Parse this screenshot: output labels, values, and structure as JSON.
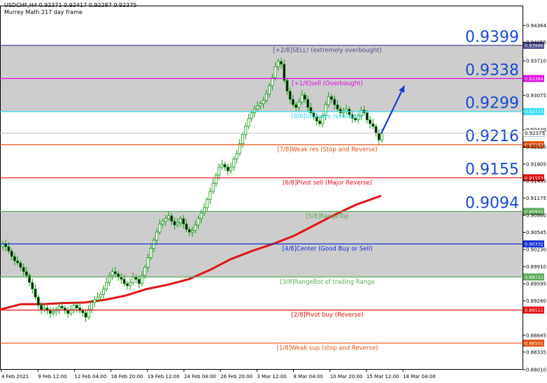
{
  "header": {
    "line1": "USDCHF,H4  0.92371 0.92417 0.92287 0.92375",
    "line2": "Murrey Math 217 day frame"
  },
  "chart_data": {
    "type": "candlestick",
    "symbol": "USDCHF",
    "timeframe": "H4",
    "ohlc": {
      "open": 0.92371,
      "high": 0.92417,
      "low": 0.92287,
      "close": 0.92375
    },
    "current_price_tag": "0.92375",
    "y_range": [
      0.8801,
      0.9473
    ],
    "y_ticks": [
      {
        "v": 0.94364,
        "label": "0.94364"
      },
      {
        "v": 0.94055,
        "label": "0.94055"
      },
      {
        "v": 0.9371,
        "label": "0.93710"
      },
      {
        "v": 0.93075,
        "label": "0.93075"
      },
      {
        "v": 0.9244,
        "label": "0.92440"
      },
      {
        "v": 0.92125,
        "label": "0.92125"
      },
      {
        "v": 0.91805,
        "label": "0.91805"
      },
      {
        "v": 0.91495,
        "label": "0.91495"
      },
      {
        "v": 0.91175,
        "label": "0.91175"
      },
      {
        "v": 0.9086,
        "label": "0.90860"
      },
      {
        "v": 0.90545,
        "label": "0.90545"
      },
      {
        "v": 0.9023,
        "label": "0.90230"
      },
      {
        "v": 0.8991,
        "label": "0.89910"
      },
      {
        "v": 0.89595,
        "label": "0.89595"
      },
      {
        "v": 0.8928,
        "label": "0.89280"
      },
      {
        "v": 0.88645,
        "label": "0.88645"
      },
      {
        "v": 0.88335,
        "label": "0.88335"
      },
      {
        "v": 0.8801,
        "label": "0.88010"
      }
    ],
    "x_labels": [
      "4 Feb 2021",
      "9 Feb 12:00",
      "12 Feb 04:00",
      "16 Feb 20:00",
      "19 Feb 12:00",
      "24 Feb 04:00",
      "26 Feb 20:00",
      "3 Mar 12:00",
      "8 Mar 04:00",
      "10 Mar 20:00",
      "15 Mar 12:00",
      "18 Mar 04:00"
    ],
    "bands": [
      {
        "from": 0.92773,
        "to": 0.93996,
        "color": "#cdcdcd"
      },
      {
        "from": 0.89722,
        "to": 0.90931,
        "color": "#cdcdcd"
      },
      {
        "from": 0.90931,
        "to": 0.92773,
        "color": "#ffffff"
      }
    ],
    "levels": [
      {
        "value": 0.93996,
        "tag": "0.93996",
        "label": "[+2/8]SELL! (extremely overbought)",
        "color": "#4a4a8c",
        "big": "0.9399"
      },
      {
        "value": 0.93384,
        "tag": "0.93384",
        "label": "[+1/8]sell (Overbought)",
        "color": "#e010e0",
        "big": "0.9338"
      },
      {
        "value": 0.92773,
        "tag": "0.92773",
        "label": "[8/8]Ultimate resistance",
        "color": "#33dff0",
        "big": "0.9299"
      },
      {
        "value": 0.92163,
        "tag": "0.92163",
        "label": "[7/8]Weak res (Stop and Reverse)",
        "color": "#e05010",
        "big": "0.9216"
      },
      {
        "value": 0.91553,
        "tag": "0.91553",
        "label": "[6/8]Pivot sell (Major Reverse)",
        "color": "#e01010",
        "big": "0.9155"
      },
      {
        "value": 0.90931,
        "tag": "0.90931",
        "label": "[5/8]RangeTop",
        "color": "#5aaa5a",
        "big": "0.9094"
      },
      {
        "value": 0.90332,
        "tag": "0.90332",
        "label": "[4/8]Center (Good Buy or Sell)",
        "color": "#1030d0",
        "big": ""
      },
      {
        "value": 0.89722,
        "tag": "0.89722",
        "label": "[3/8]RangeBot of trading Range",
        "color": "#5aaa5a",
        "big": ""
      },
      {
        "value": 0.89111,
        "tag": "0.89111",
        "label": "[2/8]Pivot buy (Reverse)",
        "color": "#e01010",
        "big": ""
      },
      {
        "value": 0.88501,
        "tag": "0.88501",
        "label": "[1/8]Weak sup (stop and Reverse)",
        "color": "#e05010",
        "big": ""
      }
    ],
    "closes": [
      0.9034,
      0.9028,
      0.902,
      0.901,
      0.9002,
      0.8998,
      0.899,
      0.8982,
      0.8975,
      0.8962,
      0.895,
      0.8935,
      0.892,
      0.8912,
      0.8915,
      0.891,
      0.8905,
      0.8908,
      0.8912,
      0.8918,
      0.8915,
      0.891,
      0.8905,
      0.8912,
      0.892,
      0.8915,
      0.891,
      0.8906,
      0.8898,
      0.8912,
      0.8925,
      0.893,
      0.8935,
      0.894,
      0.895,
      0.8962,
      0.8975,
      0.8982,
      0.8978,
      0.8972,
      0.8968,
      0.896,
      0.8956,
      0.8962,
      0.8972,
      0.8968,
      0.896,
      0.8975,
      0.899,
      0.9008,
      0.9025,
      0.904,
      0.9055,
      0.907,
      0.9075,
      0.908,
      0.9085,
      0.9075,
      0.9068,
      0.9072,
      0.908,
      0.907,
      0.906,
      0.9055,
      0.9058,
      0.9068,
      0.908,
      0.909,
      0.91,
      0.9115,
      0.913,
      0.9145,
      0.916,
      0.9175,
      0.918,
      0.9175,
      0.9168,
      0.9175,
      0.919,
      0.92,
      0.9218,
      0.9235,
      0.925,
      0.9265,
      0.9275,
      0.9282,
      0.9288,
      0.9292,
      0.9298,
      0.931,
      0.9325,
      0.934,
      0.936,
      0.937,
      0.9365,
      0.9335,
      0.9315,
      0.93,
      0.929,
      0.9285,
      0.9295,
      0.9308,
      0.93,
      0.9285,
      0.9275,
      0.9268,
      0.926,
      0.9255,
      0.927,
      0.929,
      0.9305,
      0.93,
      0.929,
      0.9282,
      0.9275,
      0.9278,
      0.9282,
      0.9272,
      0.9265,
      0.9262,
      0.927,
      0.928,
      0.9275,
      0.9262,
      0.9255,
      0.925,
      0.9238,
      0.9225,
      0.9237
    ],
    "ma": [
      [
        0,
        0.8912
      ],
      [
        30,
        0.8922
      ],
      [
        60,
        0.8922
      ],
      [
        90,
        0.8924
      ],
      [
        120,
        0.8925
      ],
      [
        150,
        0.893
      ],
      [
        180,
        0.8938
      ],
      [
        210,
        0.895
      ],
      [
        240,
        0.8958
      ],
      [
        270,
        0.8968
      ],
      [
        300,
        0.8985
      ],
      [
        330,
        0.9005
      ],
      [
        360,
        0.902
      ],
      [
        390,
        0.9033
      ],
      [
        420,
        0.9048
      ],
      [
        450,
        0.9068
      ],
      [
        480,
        0.9088
      ],
      [
        510,
        0.9106
      ],
      [
        545,
        0.9122
      ]
    ],
    "arrow": {
      "from": [
        545,
        0.9237
      ],
      "to": [
        578,
        0.9325
      ],
      "color": "#1a3bd8"
    }
  }
}
